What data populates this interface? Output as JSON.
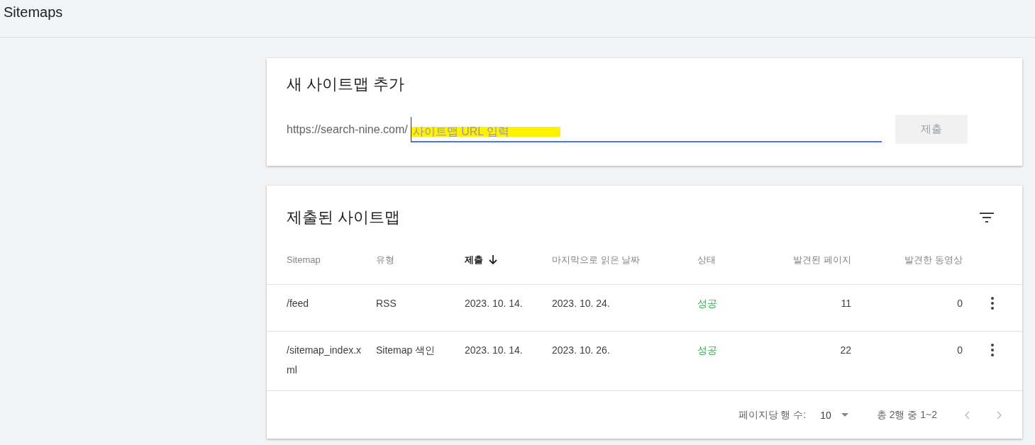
{
  "header": {
    "title": "Sitemaps"
  },
  "add_card": {
    "title": "새 사이트맵 추가",
    "prefix": "https://search-nine.com/",
    "placeholder": "사이트맵 URL 입력",
    "highlighted": true,
    "submit": {
      "label": "제출",
      "disabled": true
    }
  },
  "list_card": {
    "title": "제출된 사이트맵",
    "columns": [
      {
        "label": "Sitemap",
        "sorted": false
      },
      {
        "label": "유형",
        "sorted": false
      },
      {
        "label": "제출",
        "sorted": true
      },
      {
        "label": "마지막으로 읽은 날짜",
        "sorted": false
      },
      {
        "label": "상태",
        "sorted": false
      },
      {
        "label": "발견된 페이지",
        "sorted": false
      },
      {
        "label": "발견한 동영상",
        "sorted": false
      }
    ],
    "rows": [
      {
        "cells": [
          "/feed",
          "RSS",
          "2023. 10. 14.",
          "2023. 10. 24.",
          "성공",
          "11",
          "0"
        ]
      },
      {
        "cells": [
          "/sitemap_index.xml",
          "Sitemap 색인",
          "2023. 10. 14.",
          "2023. 10. 26.",
          "성공",
          "22",
          "0"
        ]
      }
    ],
    "footer": {
      "rows_label": "페이지당 행 수:",
      "rows_value": "10",
      "range": "총 2행 중 1~2"
    }
  }
}
